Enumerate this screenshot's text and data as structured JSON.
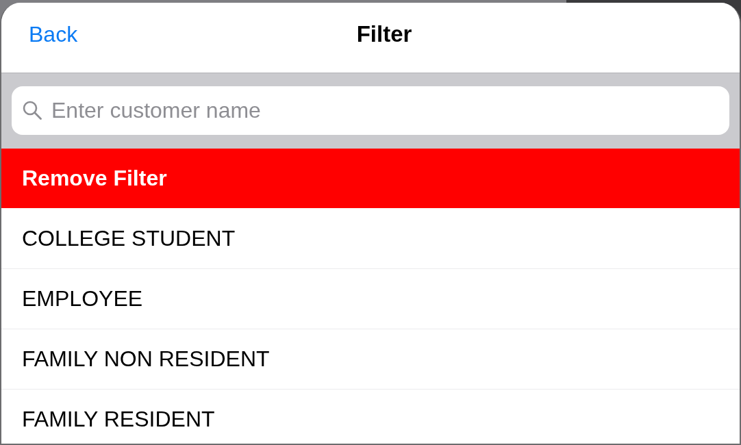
{
  "nav_bar": {
    "back_label": "Back",
    "title": "Filter"
  },
  "search": {
    "placeholder": "Enter customer name"
  },
  "remove_filter": {
    "label": "Remove Filter"
  },
  "filters": [
    {
      "label": "COLLEGE STUDENT",
      "selected": false
    },
    {
      "label": "EMPLOYEE",
      "selected": false
    },
    {
      "label": "FAMILY NON RESIDENT",
      "selected": false
    },
    {
      "label": "FAMILY RESIDENT",
      "selected": false
    }
  ]
}
